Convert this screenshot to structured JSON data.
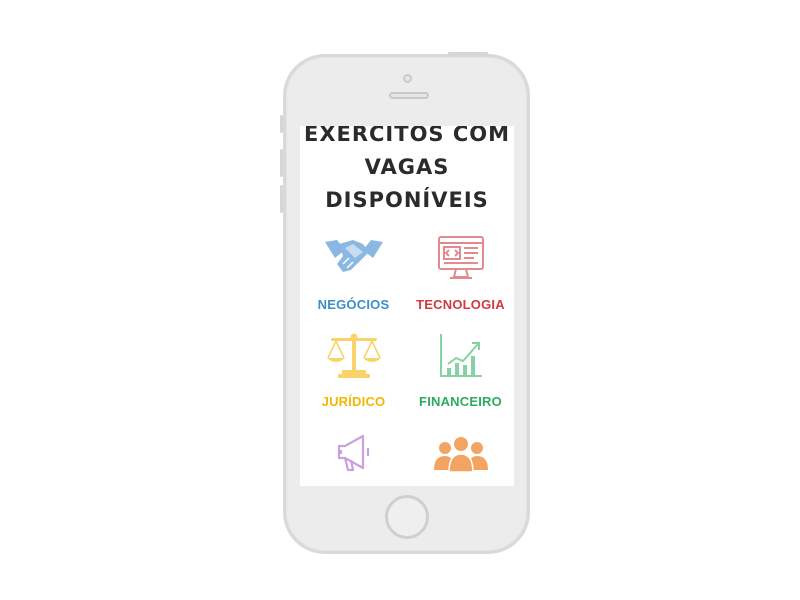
{
  "screen": {
    "heading_lines": [
      "EXERCITOS COM",
      "VAGAS",
      "DISPONÍVEIS"
    ]
  },
  "categories": [
    {
      "label": "NEGÓCIOS",
      "icon": "handshake-icon",
      "color": "#3a8fc9",
      "icon_color": "#8ab8e3"
    },
    {
      "label": "TECNOLOGIA",
      "icon": "computer-code-icon",
      "color": "#d0393f",
      "icon_color": "#e28a8e"
    },
    {
      "label": "JURÍDICO",
      "icon": "scales-icon",
      "color": "#f2b705",
      "icon_color": "#f7d36a"
    },
    {
      "label": "FINANCEIRO",
      "icon": "growth-chart-icon",
      "color": "#2eab5e",
      "icon_color": "#86d2a3"
    },
    {
      "label": "",
      "icon": "megaphone-icon",
      "color": "#b07ad0",
      "icon_color": "#c9a0e0"
    },
    {
      "label": "",
      "icon": "team-icon",
      "color": "#f08c3c",
      "icon_color": "#f4a462"
    }
  ]
}
